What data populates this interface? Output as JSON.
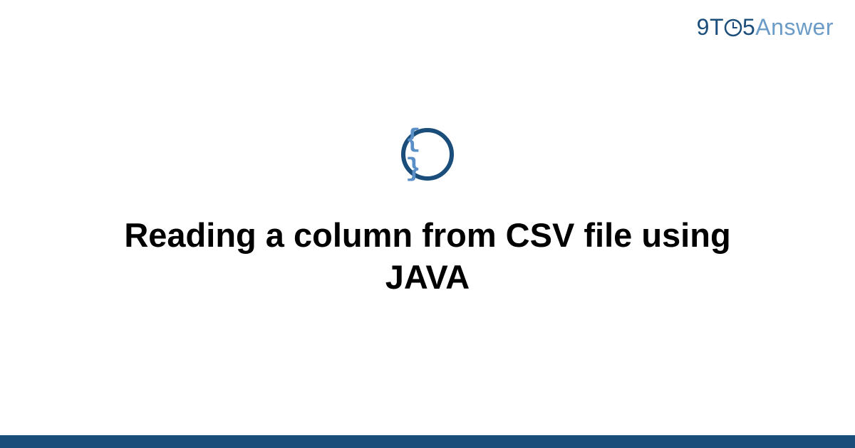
{
  "brand": {
    "part1": "9T",
    "part2": "5",
    "part3": "Answer"
  },
  "icon": {
    "name": "code-braces-icon",
    "glyph": "{ }"
  },
  "title": "Reading a column from CSV file using JAVA",
  "colors": {
    "primary": "#1a4d7a",
    "accent": "#5a8fc7",
    "light": "#6b9bc7"
  }
}
